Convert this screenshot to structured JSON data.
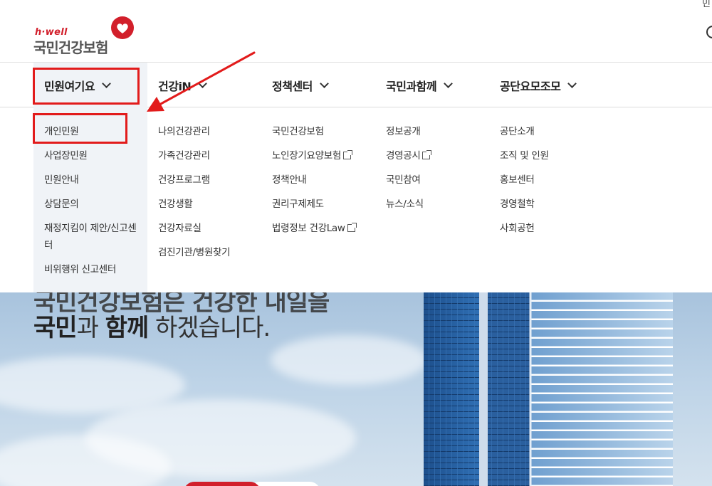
{
  "logo": {
    "sub": "h·well",
    "main": "국민건강보험"
  },
  "header": {
    "top_right_glyph": "민"
  },
  "gnb": [
    {
      "label": "민원여기요"
    },
    {
      "label": "건강iN"
    },
    {
      "label": "정책센터"
    },
    {
      "label": "국민과함께"
    },
    {
      "label": "공단요모조모"
    }
  ],
  "menu": {
    "col1": [
      "개인민원",
      "사업장민원",
      "민원안내",
      "상담문의",
      "재정지킴이 제안/신고센터",
      "비위행위 신고센터"
    ],
    "col2": [
      "나의건강관리",
      "가족건강관리",
      "건강프로그램",
      "건강생활",
      "건강자료실",
      "검진기관/병원찾기"
    ],
    "col3": [
      "국민건강보험",
      "노인장기요양보험",
      "정책안내",
      "권리구제제도",
      "법령정보 건강Law"
    ],
    "col4": [
      "정보공개",
      "경영공시",
      "국민참여",
      "뉴스/소식"
    ],
    "col5": [
      "공단소개",
      "조직 및 인원",
      "홍보센터",
      "경영철학",
      "사회공헌"
    ]
  },
  "hero": {
    "line1": "국민건강보험은 건강한 내일을",
    "line2_b1": "국민",
    "line2_t1": "과 ",
    "line2_b2": "함께",
    "line2_t2": " 하겠습니다."
  },
  "colors": {
    "brand_red": "#d21f2b",
    "annotation_red": "#e21b1b",
    "menu_bg": "#f0f3f7"
  }
}
